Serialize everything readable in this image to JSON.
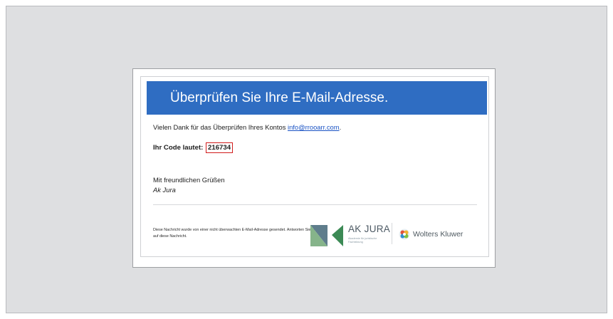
{
  "email": {
    "banner_title": "Überprüfen Sie Ihre E-Mail-Adresse.",
    "thanks_text": "Vielen Dank für das Überprüfen Ihres Kontos ",
    "account_email": "info@rrooarr.com",
    "thanks_suffix": ".",
    "code_label": "Ihr Code lautet: ",
    "code_value": "216734",
    "greeting": "Mit freundlichen Grüßen",
    "signature": "Ak Jura"
  },
  "footer": {
    "note": "Diese Nachricht wurde von einer nicht überwachten E-Mail-Adresse gesendet. Antworten Sie nicht auf diese Nachricht.",
    "akjura_logo_text": "AK JURA",
    "akjura_tagline": "Akademie für juristische Fachbildung",
    "partner_logo_text": "Wolters Kluwer"
  },
  "colors": {
    "banner": "#2f6dc2",
    "code_highlight": "#d11c1c",
    "link": "#1a53c4",
    "background": "#dedfe1"
  },
  "icons": {
    "akjura_logo": "akjura-logo-icon",
    "wolters_kluwer_logo": "wolters-kluwer-logo-icon"
  }
}
